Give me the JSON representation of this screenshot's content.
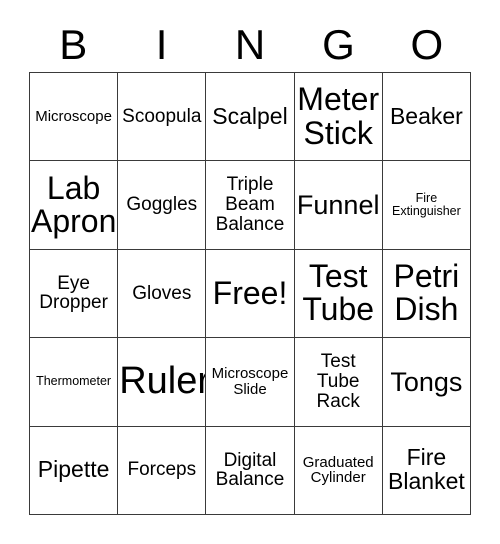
{
  "card": {
    "title_letters": [
      "B",
      "I",
      "N",
      "G",
      "O"
    ],
    "free_space": "Free!",
    "border_color": "#3a3a3a",
    "background_color": "#ffffff",
    "text_color": "#000000",
    "columns": 5,
    "rows": 5
  },
  "grid": [
    [
      {
        "label": "Microscope",
        "size": "sm"
      },
      {
        "label": "Scoopula",
        "size": "md"
      },
      {
        "label": "Scalpel",
        "size": "lg"
      },
      {
        "label": "Meter\nStick",
        "size": "xxl"
      },
      {
        "label": "Beaker",
        "size": "lg"
      }
    ],
    [
      {
        "label": "Lab\nApron",
        "size": "xxl"
      },
      {
        "label": "Goggles",
        "size": "md"
      },
      {
        "label": "Triple\nBeam\nBalance",
        "size": "md"
      },
      {
        "label": "Funnel",
        "size": "xl"
      },
      {
        "label": "Fire\nExtinguisher",
        "size": "xs"
      }
    ],
    [
      {
        "label": "Eye\nDropper",
        "size": "md"
      },
      {
        "label": "Gloves",
        "size": "md"
      },
      {
        "label": "Free!",
        "size": "xxl"
      },
      {
        "label": "Test\nTube",
        "size": "xxl"
      },
      {
        "label": "Petri\nDish",
        "size": "xxl"
      }
    ],
    [
      {
        "label": "Thermometer",
        "size": "xs"
      },
      {
        "label": "Ruler",
        "size": "huge"
      },
      {
        "label": "Microscope\nSlide",
        "size": "sm"
      },
      {
        "label": "Test\nTube\nRack",
        "size": "md"
      },
      {
        "label": "Tongs",
        "size": "xl"
      }
    ],
    [
      {
        "label": "Pipette",
        "size": "lg"
      },
      {
        "label": "Forceps",
        "size": "md"
      },
      {
        "label": "Digital\nBalance",
        "size": "md"
      },
      {
        "label": "Graduated\nCylinder",
        "size": "sm"
      },
      {
        "label": "Fire\nBlanket",
        "size": "lg"
      }
    ]
  ]
}
